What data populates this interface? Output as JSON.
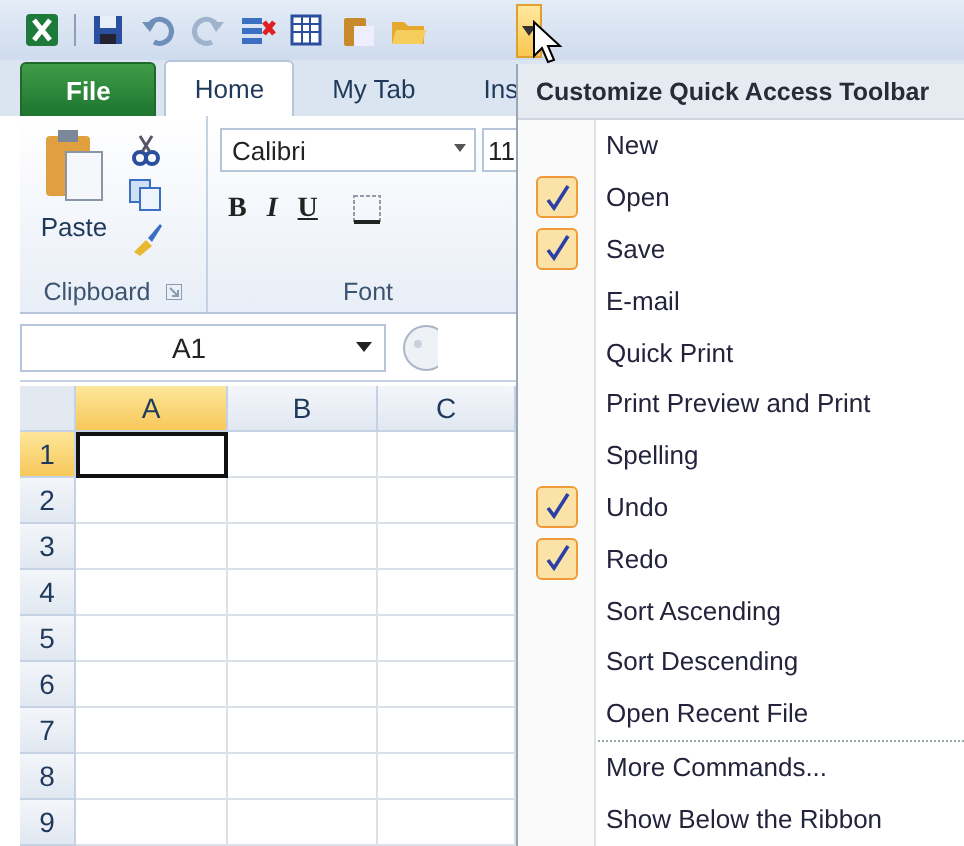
{
  "quick_access_toolbar": {
    "customize_button": {
      "selected": true
    }
  },
  "ribbon": {
    "tabs": [
      {
        "label": "File",
        "kind": "file",
        "selected": false
      },
      {
        "label": "Home",
        "kind": "tab",
        "selected": true
      },
      {
        "label": "My Tab",
        "kind": "tab",
        "selected": false
      },
      {
        "label": "Ins",
        "kind": "tab",
        "selected": false
      }
    ],
    "clipboard": {
      "paste_label": "Paste",
      "group_label": "Clipboard"
    },
    "font": {
      "font_name": "Calibri",
      "font_size": "11",
      "bold": "B",
      "italic": "I",
      "underline": "U",
      "group_label": "Font"
    }
  },
  "formula_bar": {
    "name_box": "A1"
  },
  "sheet": {
    "columns": [
      {
        "label": "A",
        "selected": true
      },
      {
        "label": "B",
        "selected": false
      },
      {
        "label": "C",
        "selected": false
      }
    ],
    "rows": [
      {
        "label": "1",
        "selected": true
      },
      {
        "label": "2",
        "selected": false
      },
      {
        "label": "3",
        "selected": false
      },
      {
        "label": "4",
        "selected": false
      },
      {
        "label": "5",
        "selected": false
      },
      {
        "label": "6",
        "selected": false
      },
      {
        "label": "7",
        "selected": false
      },
      {
        "label": "8",
        "selected": false
      },
      {
        "label": "9",
        "selected": false
      }
    ]
  },
  "menu": {
    "title": "Customize Quick Access Toolbar",
    "items": [
      {
        "label": "New",
        "checked": false
      },
      {
        "label": "Open",
        "checked": true
      },
      {
        "label": "Save",
        "checked": true
      },
      {
        "label": "E-mail",
        "checked": false
      },
      {
        "label": "Quick Print",
        "checked": false
      },
      {
        "label": "Print Preview and Print",
        "checked": false
      },
      {
        "label": "Spelling",
        "checked": false
      },
      {
        "label": "Undo",
        "checked": true
      },
      {
        "label": "Redo",
        "checked": true
      },
      {
        "label": "Sort Ascending",
        "checked": false
      },
      {
        "label": "Sort Descending",
        "checked": false
      },
      {
        "label": "Open Recent File",
        "checked": false
      }
    ],
    "more_items": [
      {
        "label": "More Commands..."
      },
      {
        "label": "Show Below the Ribbon"
      }
    ]
  }
}
